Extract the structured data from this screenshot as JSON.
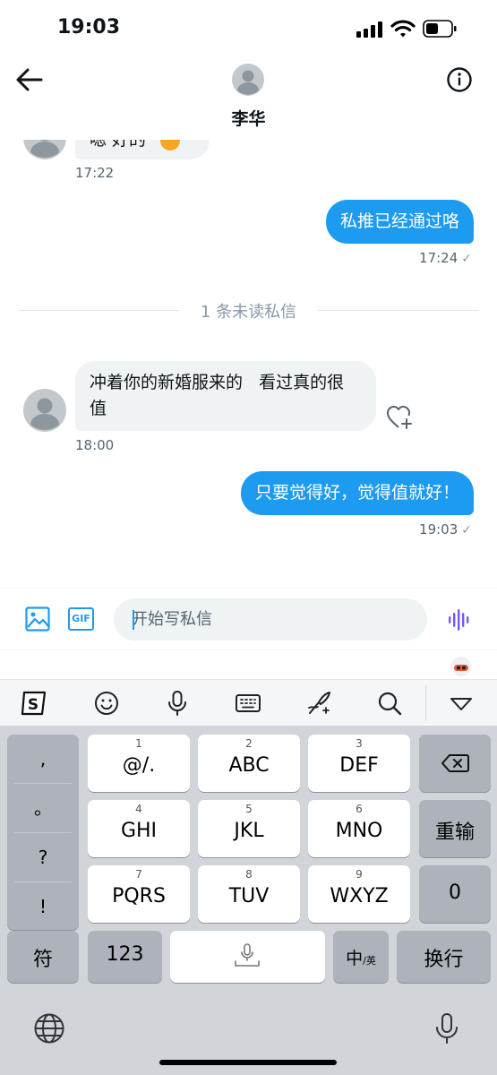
{
  "status_bar": {
    "time": "19:03"
  },
  "header": {
    "contact_name": "李华"
  },
  "chat": {
    "partial_message": {
      "text": "嗯 好的",
      "time": "17:22"
    },
    "sent_1": {
      "text": "私推已经通过咯",
      "time": "17:24",
      "status": "✓"
    },
    "unread_divider": "1 条未读私信",
    "received_1": {
      "line1": "冲着你的新婚服来的   看过真的很",
      "line2": "值",
      "time": "18:00"
    },
    "sent_2": {
      "text": "只要觉得好，觉得值就好！",
      "time": "19:03",
      "status": "✓"
    }
  },
  "composer": {
    "placeholder": "开始写私信",
    "gif_label": "GIF"
  },
  "keyboard": {
    "punctuation": [
      ",",
      "。",
      "?",
      "!"
    ],
    "keys": [
      {
        "num": "1",
        "label": "@/."
      },
      {
        "num": "2",
        "label": "ABC"
      },
      {
        "num": "3",
        "label": "DEF"
      },
      {
        "num": "4",
        "label": "GHI"
      },
      {
        "num": "5",
        "label": "JKL"
      },
      {
        "num": "6",
        "label": "MNO"
      },
      {
        "num": "7",
        "label": "PQRS"
      },
      {
        "num": "8",
        "label": "TUV"
      },
      {
        "num": "9",
        "label": "WXYZ"
      }
    ],
    "reinput": "重输",
    "zero": "0",
    "symbols": "符",
    "numbers": "123",
    "lang_main": "中",
    "lang_sub": "/英",
    "enter": "换行"
  },
  "colors": {
    "accent": "#1d9bf0",
    "incoming_bubble": "#eff3f4",
    "keyboard_bg": "#d1d4d9"
  },
  "icons": [
    "back-arrow-icon",
    "info-icon",
    "image-icon",
    "gif-icon",
    "voice-wave-icon",
    "sogou-logo-icon",
    "emoji-icon",
    "microphone-icon",
    "keyboard-icon",
    "handwriting-icon",
    "search-icon",
    "collapse-icon",
    "backspace-icon",
    "globe-icon",
    "heart-plus-icon"
  ]
}
